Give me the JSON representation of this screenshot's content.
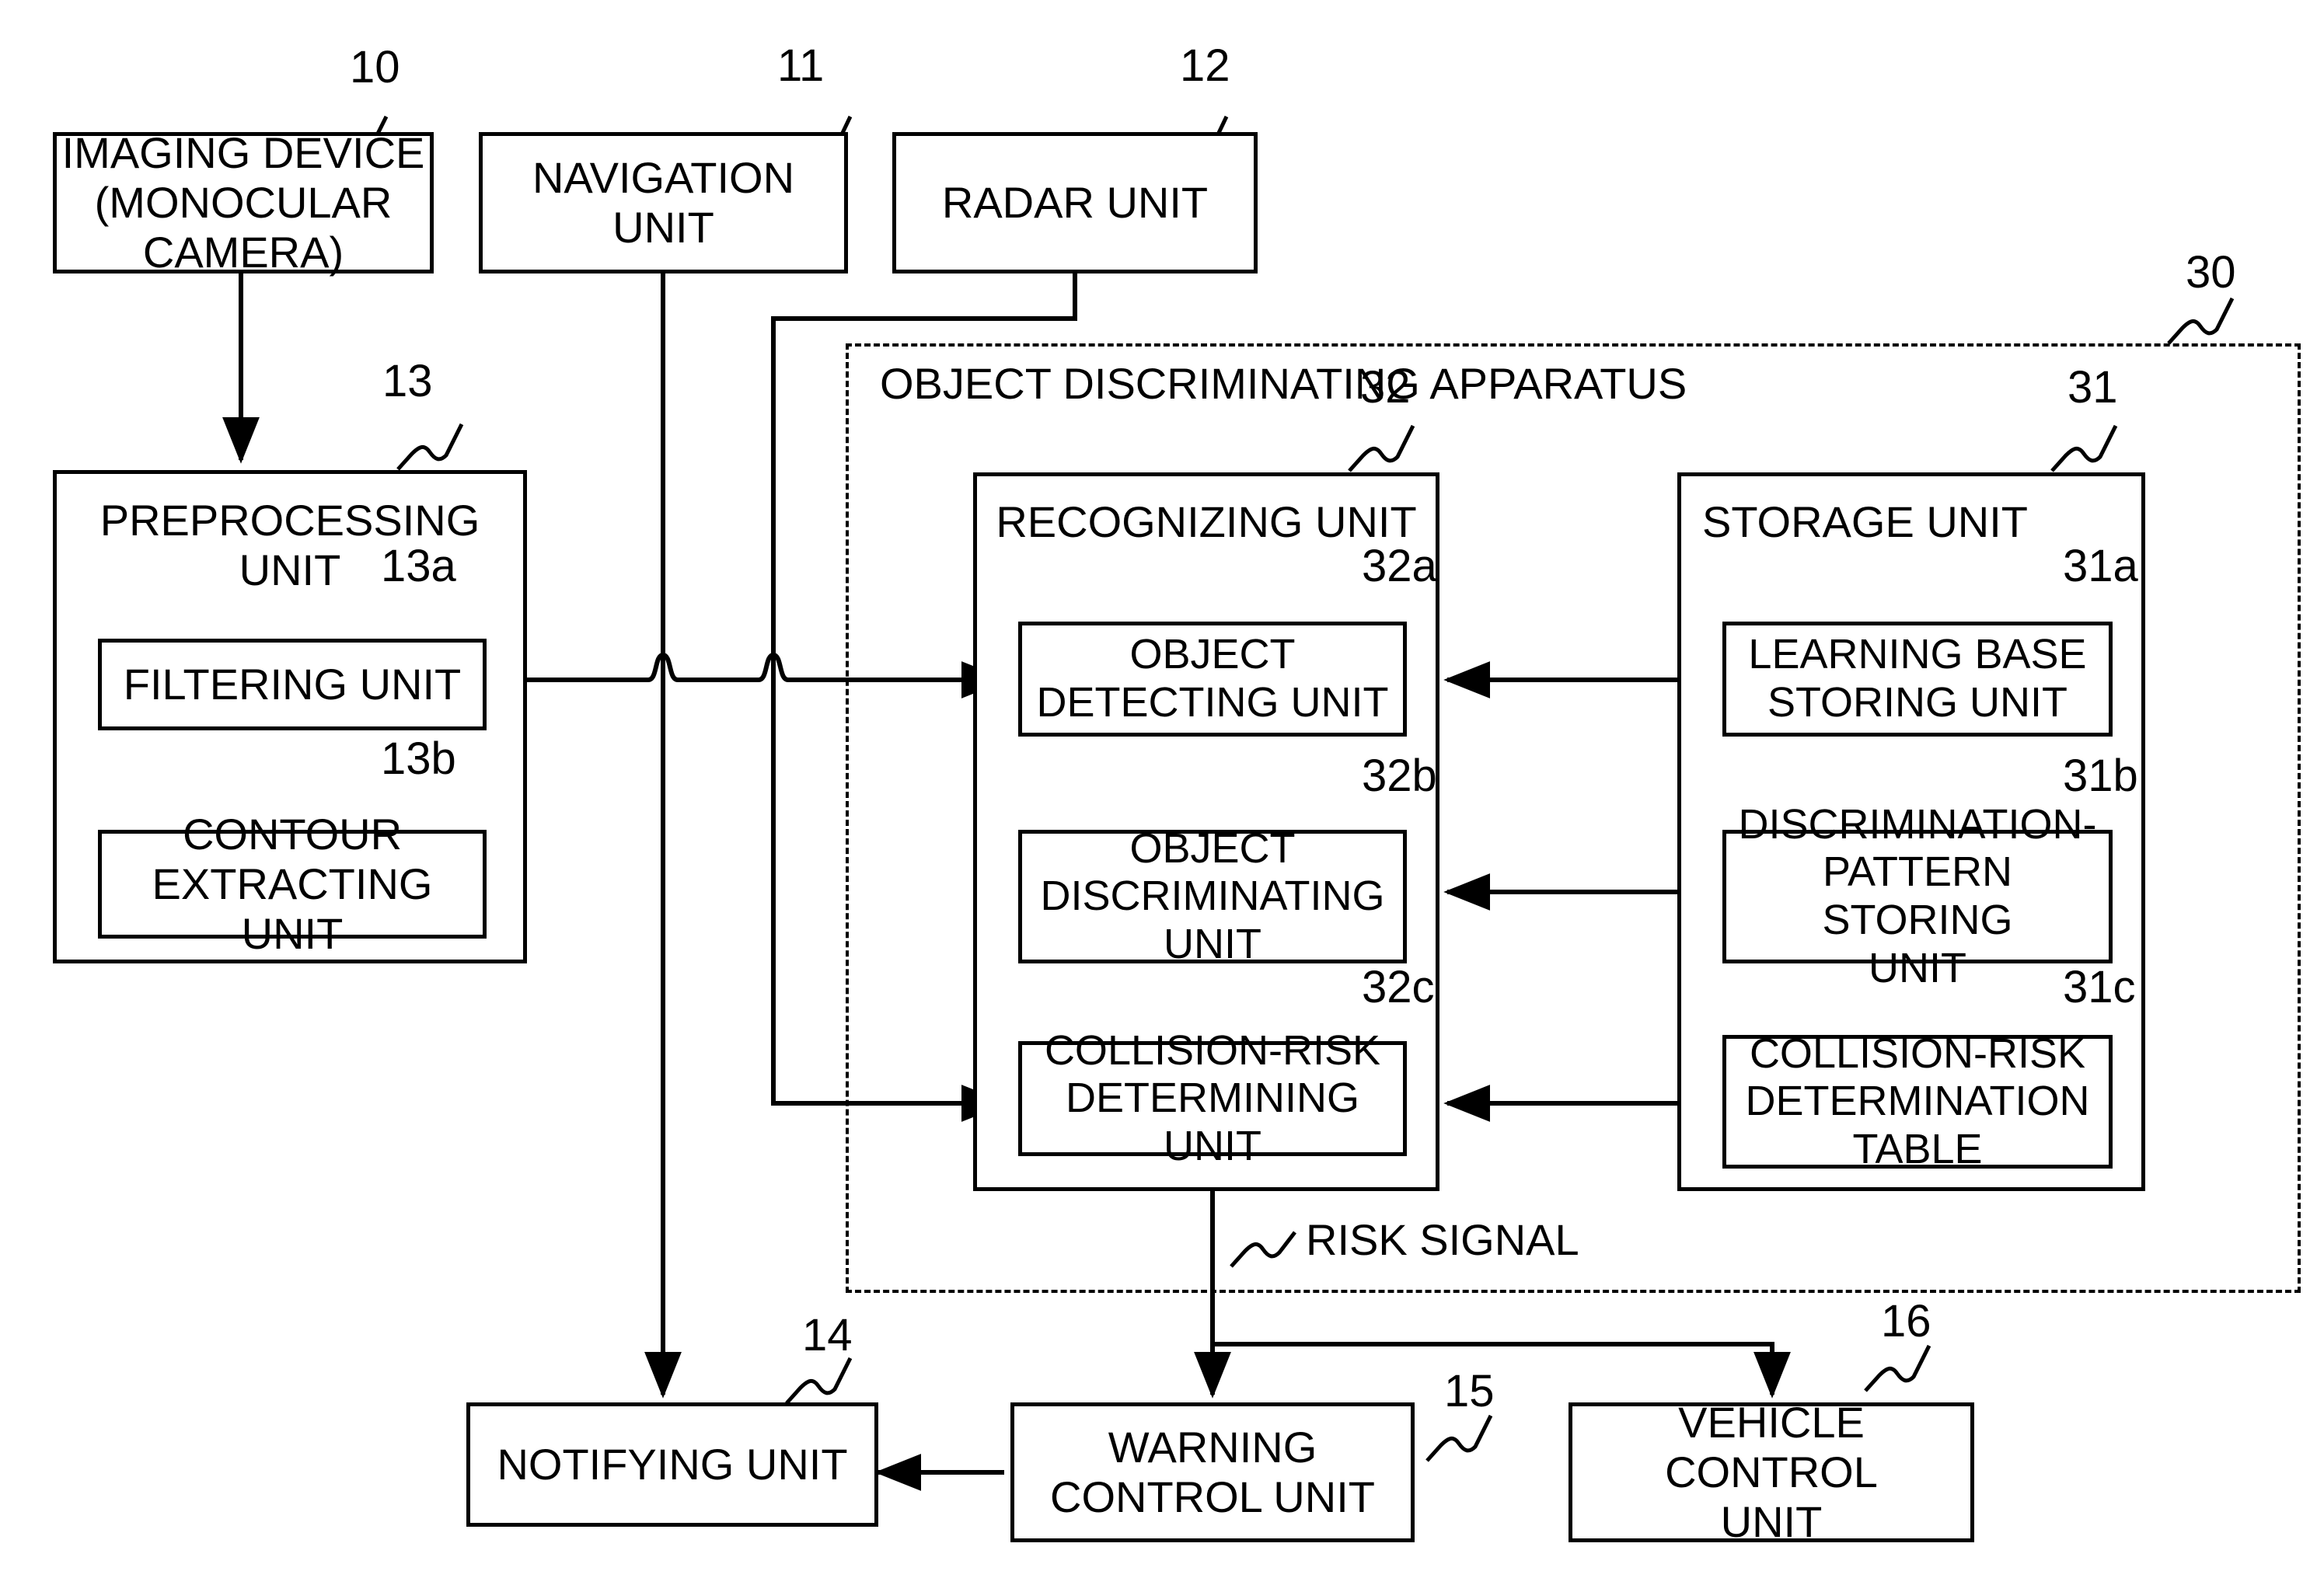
{
  "figure": {
    "kind": "patent-block-diagram",
    "apparatus_label": "OBJECT DISCRIMINATING APPARATUS",
    "apparatus_ref": "30",
    "risk_signal_label": "RISK SIGNAL"
  },
  "blocks": {
    "imaging_device": {
      "label": "IMAGING DEVICE\n(MONOCULAR\nCAMERA)",
      "ref": "10"
    },
    "navigation_unit": {
      "label": "NAVIGATION UNIT",
      "ref": "11"
    },
    "radar_unit": {
      "label": "RADAR UNIT",
      "ref": "12"
    },
    "preprocessing_unit": {
      "label": "PREPROCESSING\nUNIT",
      "ref": "13"
    },
    "filtering_unit": {
      "label": "FILTERING UNIT",
      "ref": "13a"
    },
    "contour_extracting_unit": {
      "label": "CONTOUR\nEXTRACTING UNIT",
      "ref": "13b"
    },
    "recognizing_unit": {
      "label": "RECOGNIZING UNIT",
      "ref": "32"
    },
    "object_detecting_unit": {
      "label": "OBJECT\nDETECTING UNIT",
      "ref": "32a"
    },
    "object_discriminating_unit": {
      "label": "OBJECT\nDISCRIMINATING\nUNIT",
      "ref": "32b"
    },
    "collision_risk_determining_unit": {
      "label": "COLLISION-RISK\nDETERMINING UNIT",
      "ref": "32c"
    },
    "storage_unit": {
      "label": "STORAGE UNIT",
      "ref": "31"
    },
    "learning_base_storing_unit": {
      "label": "LEARNING BASE\nSTORING UNIT",
      "ref": "31a"
    },
    "discrimination_pattern_storing_unit": {
      "label": "DISCRIMINATION-\nPATTERN STORING\nUNIT",
      "ref": "31b"
    },
    "collision_risk_determination_table": {
      "label": "COLLISION-RISK\nDETERMINATION\nTABLE",
      "ref": "31c"
    },
    "notifying_unit": {
      "label": "NOTIFYING UNIT",
      "ref": "14"
    },
    "warning_control_unit": {
      "label": "WARNING\nCONTROL UNIT",
      "ref": "15"
    },
    "vehicle_control_unit": {
      "label": "VEHICLE CONTROL\nUNIT",
      "ref": "16"
    }
  },
  "colors": {
    "stroke": "#000000",
    "background": "#ffffff"
  }
}
